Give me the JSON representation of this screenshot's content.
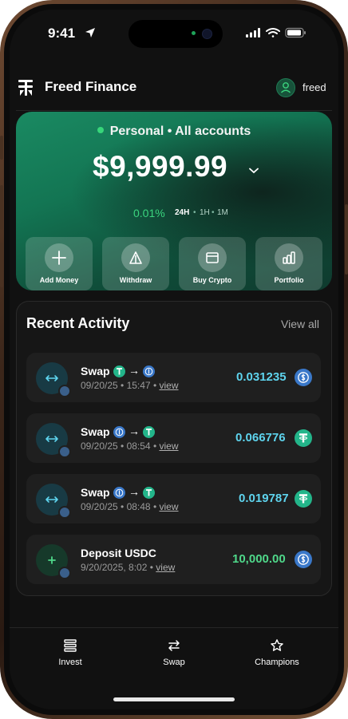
{
  "status_bar": {
    "time": "9:41"
  },
  "header": {
    "app_title": "Freed Finance",
    "username": "freed"
  },
  "balance_card": {
    "account_label": "Personal • All accounts",
    "balance": "$9,999.99",
    "change": "0.01%",
    "timeframes": [
      "24H",
      "1H",
      "1M"
    ],
    "active_timeframe": "24H",
    "actions": [
      {
        "label": "Add Money",
        "icon": "plus-icon"
      },
      {
        "label": "Withdraw",
        "icon": "withdraw-triangle-icon"
      },
      {
        "label": "Buy Crypto",
        "icon": "card-icon"
      },
      {
        "label": "Portfolio",
        "icon": "bar-chart-icon"
      }
    ]
  },
  "activity": {
    "title": "Recent Activity",
    "view_all": "View all",
    "items": [
      {
        "title": "Swap",
        "date": "09/20/25 • 15:47 •",
        "link": "view",
        "amount": "0.031235"
      },
      {
        "title": "Swap",
        "date": "09/20/25 • 08:54 •",
        "link": "view",
        "amount": "0.066776"
      },
      {
        "title": "Swap",
        "date": "09/20/25 • 08:48 •",
        "link": "view",
        "amount": "0.019787"
      },
      {
        "title": "Deposit USDC",
        "date": "9/20/2025, 8:02 •",
        "link": "view",
        "amount": "10,000.00"
      }
    ]
  },
  "bottom_nav": {
    "items": [
      {
        "label": "Invest",
        "icon": "list-icon"
      },
      {
        "label": "Swap",
        "icon": "swap-arrows-icon"
      },
      {
        "label": "Champions",
        "icon": "star-icon"
      }
    ]
  },
  "colors": {
    "accent_green": "#3bd47e",
    "amount_cyan": "#5ed4ee",
    "usdt_green": "#23b58a",
    "usdc_blue": "#3a78c9"
  }
}
